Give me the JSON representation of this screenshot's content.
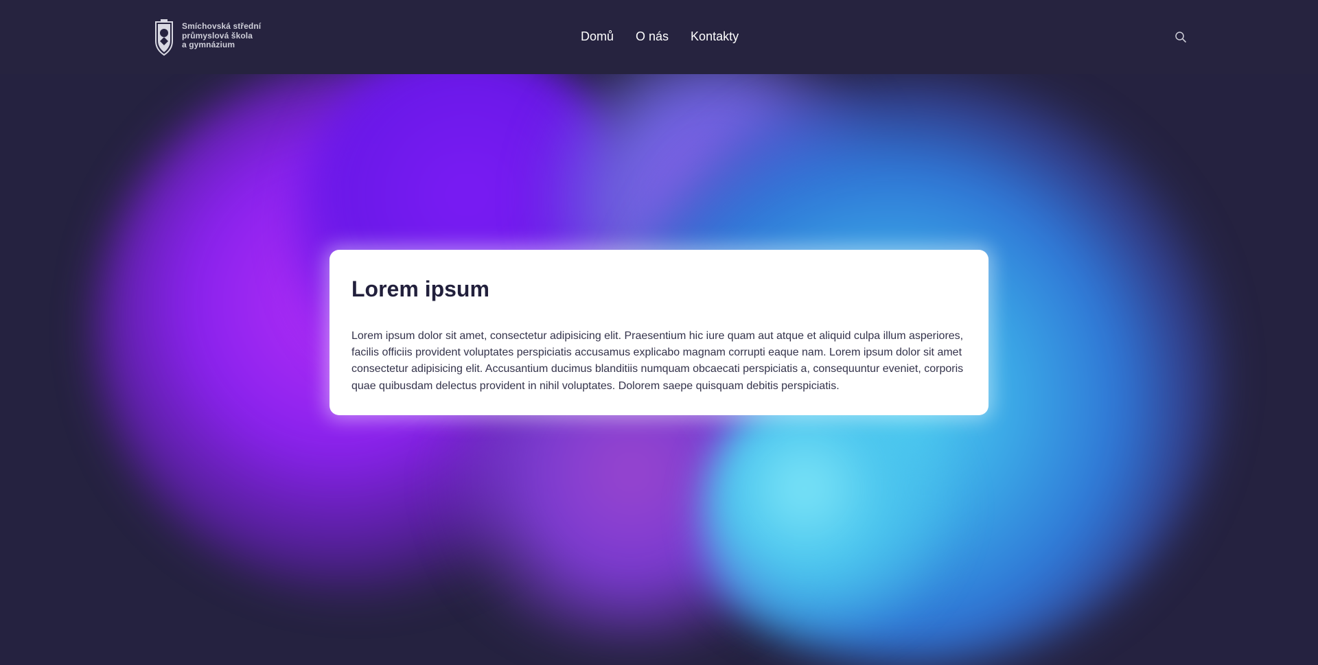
{
  "header": {
    "logo": {
      "line1": "Smíchovská střední",
      "line2": "průmyslová škola",
      "line3": "a gymnázium"
    },
    "nav": [
      "Domů",
      "O nás",
      "Kontakty"
    ],
    "search_icon": "search-icon"
  },
  "hero": {
    "title": "Lorem ipsum",
    "body": "Lorem ipsum dolor sit amet, consectetur adipisicing elit. Praesentium hic iure quam aut atque et aliquid culpa illum asperiores, facilis officiis provident voluptates perspiciatis accusamus explicabo magnam corrupti eaque nam. Lorem ipsum dolor sit amet consectetur adipisicing elit. Accusantium ducimus blanditiis numquam obcaecati perspiciatis a, consequuntur eveniet, corporis quae quibusdam delectus provident in nihil voluptates. Dolorem saepe quisquam debitis perspiciatis."
  },
  "colors": {
    "header_bg": "#26233f",
    "page_bg": "#252240",
    "title_text": "#22203c"
  }
}
